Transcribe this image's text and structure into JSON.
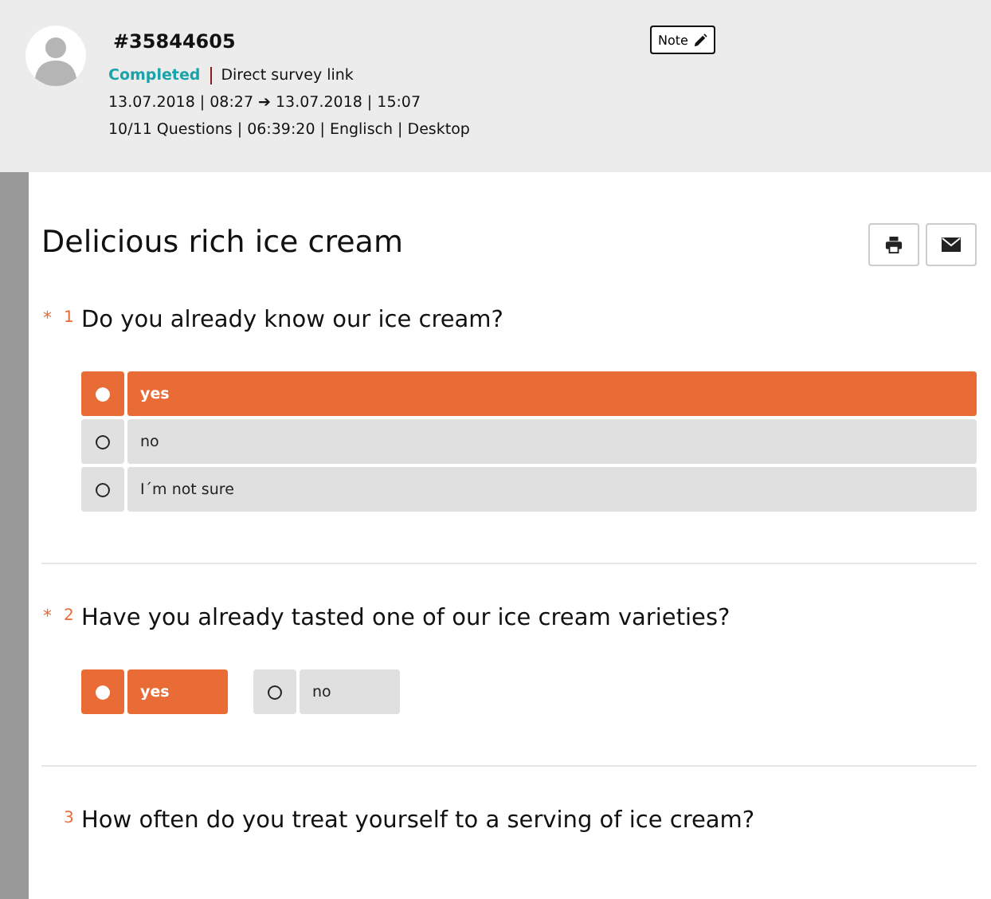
{
  "response": {
    "id": "#35844605",
    "status": "Completed",
    "source": "Direct survey link",
    "dates": "13.07.2018 | 08:27 ➔ 13.07.2018 | 15:07",
    "details": "10/11 Questions | 06:39:20 | Englisch | Desktop",
    "note_button": "Note"
  },
  "survey": {
    "title": "Delicious rich ice cream",
    "questions": [
      {
        "number": "1",
        "marker": "*",
        "text": "Do you already know our ice cream?",
        "kind": "list",
        "options": [
          {
            "label": "yes",
            "selected": true
          },
          {
            "label": "no",
            "selected": false
          },
          {
            "label": "I´m not sure",
            "selected": false
          }
        ]
      },
      {
        "number": "2",
        "marker": "*",
        "text": "Have you already tasted one of our ice cream varieties?",
        "kind": "inline",
        "options": [
          {
            "label": "yes",
            "selected": true
          },
          {
            "label": "no",
            "selected": false
          }
        ]
      },
      {
        "number": "3",
        "text": "How often do you treat yourself to a serving of ice cream?"
      }
    ]
  }
}
